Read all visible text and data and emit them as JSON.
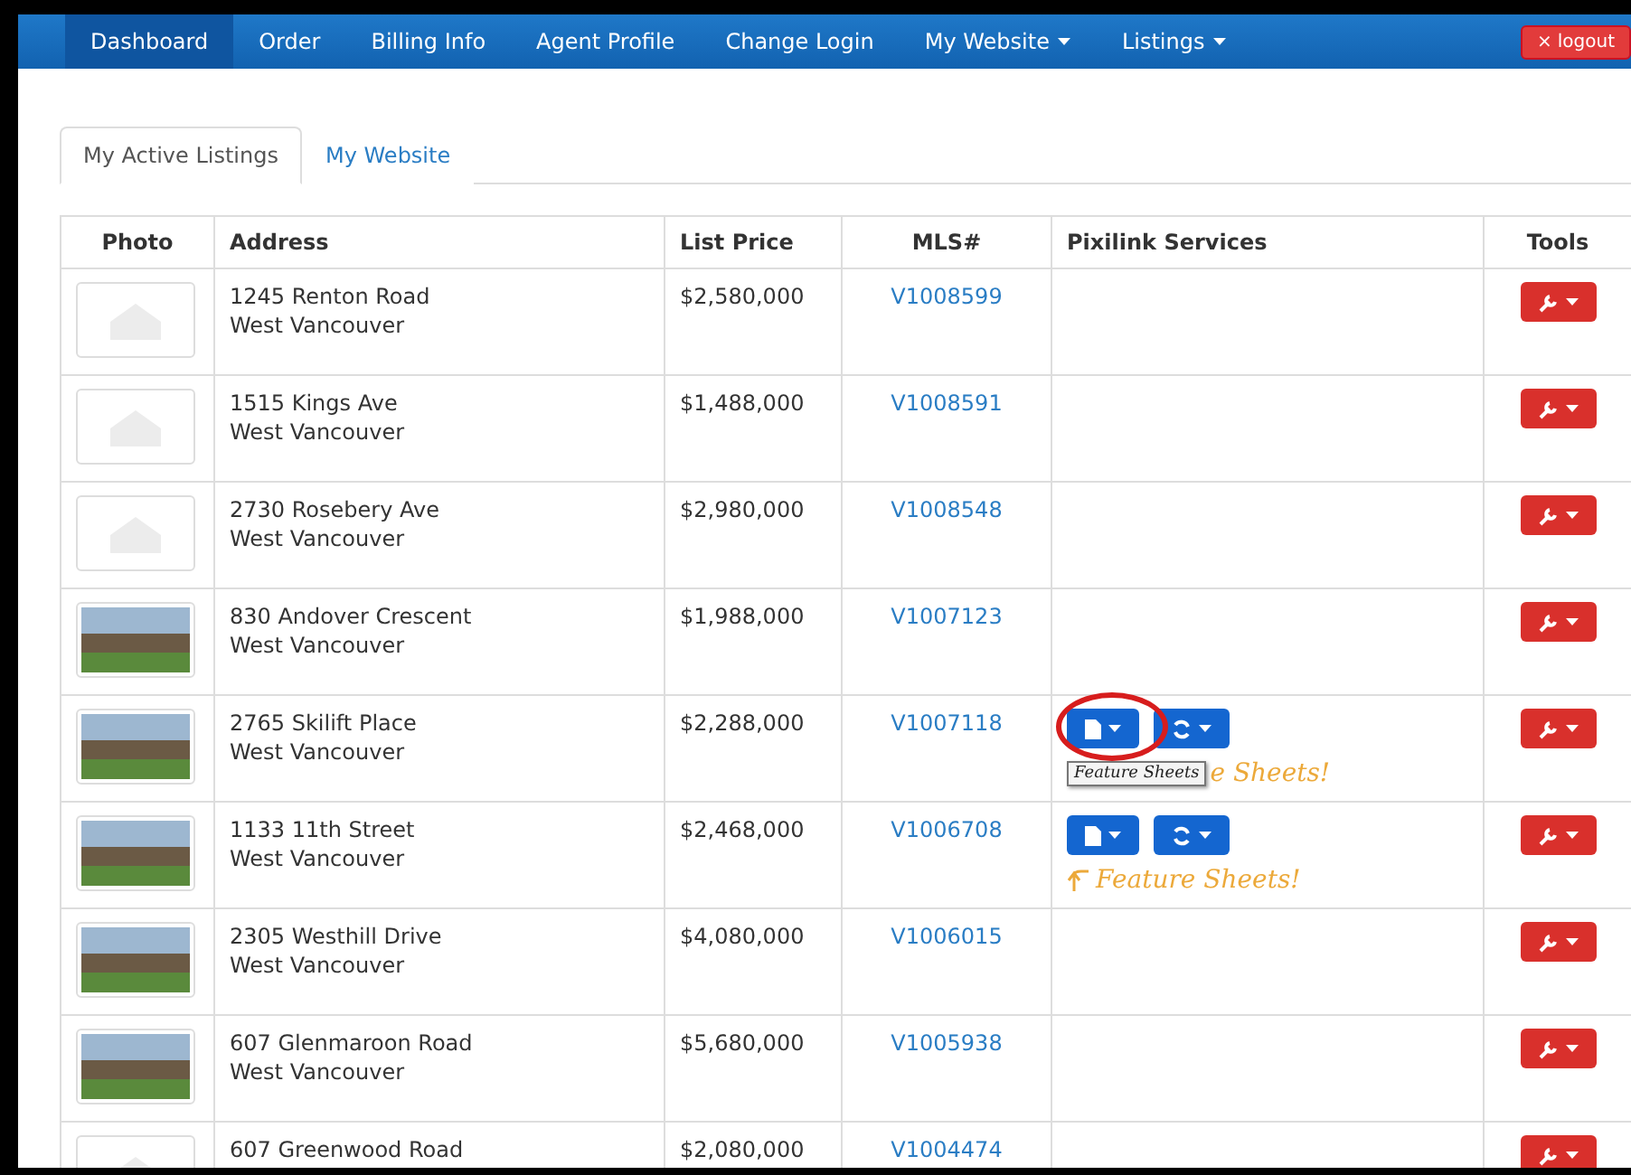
{
  "navbar": {
    "items": [
      {
        "label": "Dashboard",
        "selected": true,
        "dropdown": false
      },
      {
        "label": "Order",
        "selected": false,
        "dropdown": false
      },
      {
        "label": "Billing Info",
        "selected": false,
        "dropdown": false
      },
      {
        "label": "Agent Profile",
        "selected": false,
        "dropdown": false
      },
      {
        "label": "Change Login",
        "selected": false,
        "dropdown": false
      },
      {
        "label": "My Website",
        "selected": false,
        "dropdown": true
      },
      {
        "label": "Listings",
        "selected": false,
        "dropdown": true
      }
    ],
    "logout": {
      "icon": "×",
      "label": "logout"
    }
  },
  "tabs": [
    {
      "label": "My Active Listings",
      "selected": true
    },
    {
      "label": "My Website",
      "selected": false
    }
  ],
  "table": {
    "columns": [
      "Photo",
      "Address",
      "List Price",
      "MLS#",
      "Pixilink Services",
      "Tools"
    ],
    "rows": [
      {
        "kind": "placeholder",
        "address": "1245 Renton Road",
        "city": "West Vancouver",
        "price": "$2,580,000",
        "mls": "V1008599",
        "services": false
      },
      {
        "kind": "placeholder",
        "address": "1515 Kings Ave",
        "city": "West Vancouver",
        "price": "$1,488,000",
        "mls": "V1008591",
        "services": false
      },
      {
        "kind": "placeholder",
        "address": "2730 Rosebery Ave",
        "city": "West Vancouver",
        "price": "$2,980,000",
        "mls": "V1008548",
        "services": false
      },
      {
        "kind": "photo",
        "address": "830 Andover Crescent",
        "city": "West Vancouver",
        "price": "$1,988,000",
        "mls": "V1007123",
        "services": false
      },
      {
        "kind": "photo",
        "address": "2765 Skilift Place",
        "city": "West Vancouver",
        "price": "$2,288,000",
        "mls": "V1007118",
        "services": true,
        "highlighted": true,
        "tooltip": "Feature Sheets",
        "annotation": "e Sheets!"
      },
      {
        "kind": "photo",
        "address": "1133 11th Street",
        "city": "West Vancouver",
        "price": "$2,468,000",
        "mls": "V1006708",
        "services": true,
        "annotation": "Feature Sheets!",
        "annotation_arrow": true
      },
      {
        "kind": "photo",
        "address": "2305 Westhill Drive",
        "city": "West Vancouver",
        "price": "$4,080,000",
        "mls": "V1006015",
        "services": false
      },
      {
        "kind": "photo",
        "address": "607 Glenmaroon Road",
        "city": "West Vancouver",
        "price": "$5,680,000",
        "mls": "V1005938",
        "services": false
      },
      {
        "kind": "placeholder",
        "address": "607 Greenwood Road",
        "price": "$2,080,000",
        "mls": "V1004474",
        "services": false
      }
    ]
  }
}
